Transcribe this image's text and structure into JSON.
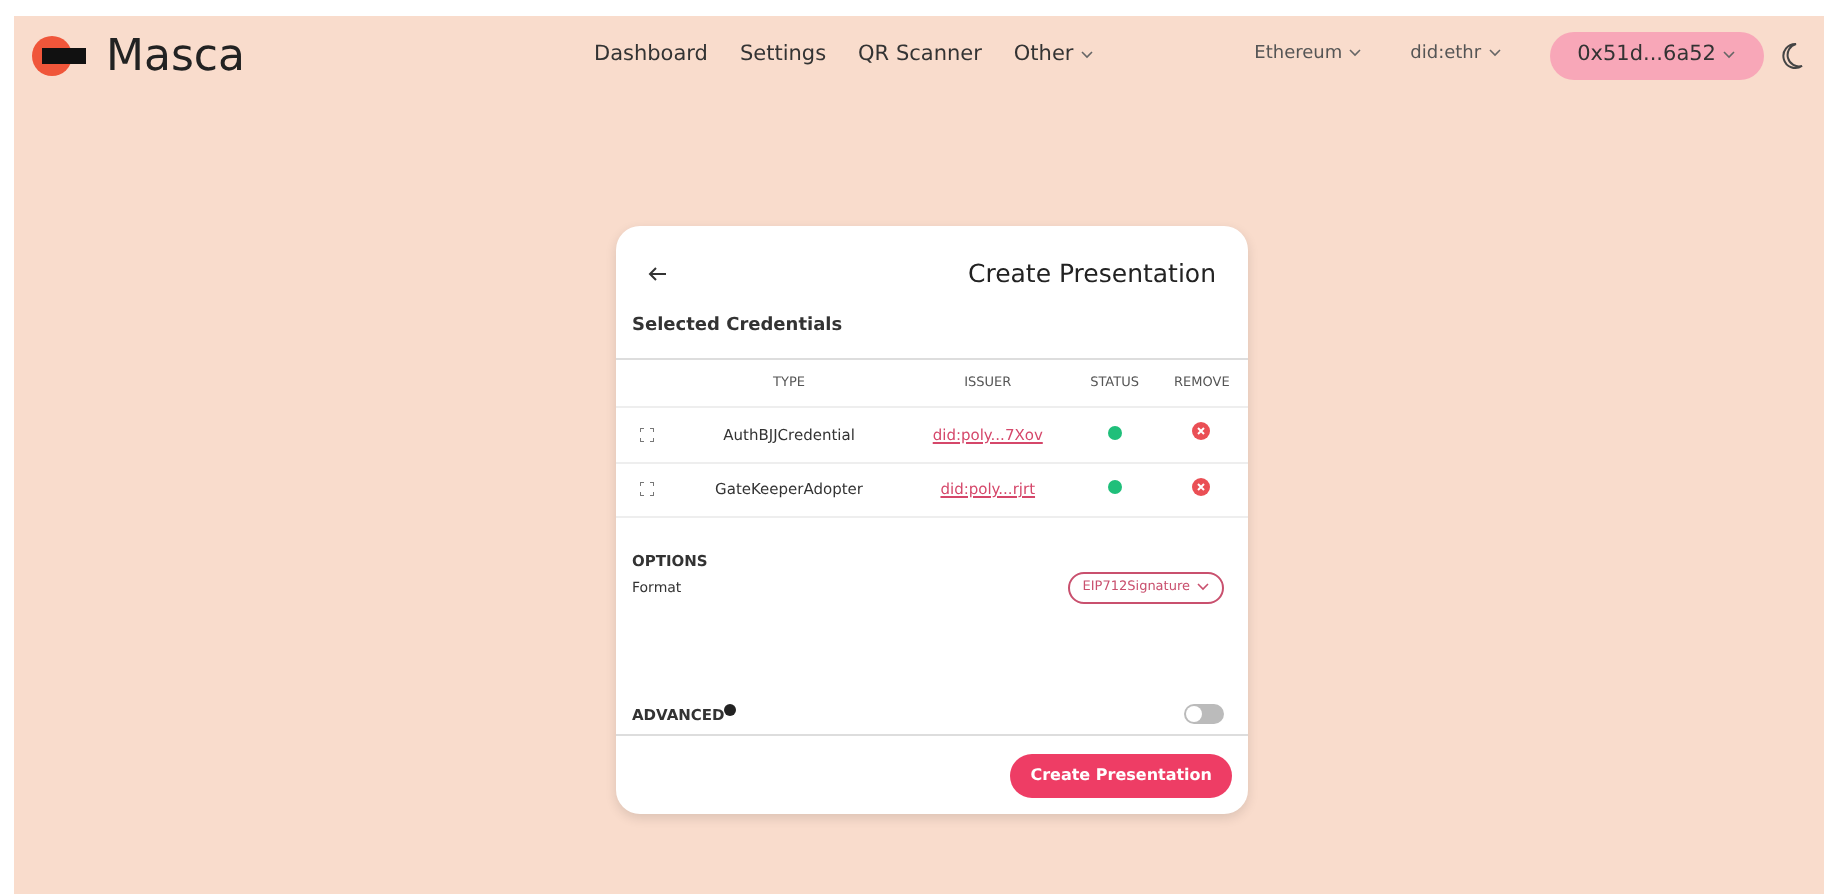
{
  "brand": {
    "name": "Masca"
  },
  "nav": [
    {
      "label": "Dashboard",
      "kind": "link"
    },
    {
      "label": "Settings",
      "kind": "link"
    },
    {
      "label": "QR Scanner",
      "kind": "link"
    },
    {
      "label": "Other",
      "kind": "dropdown"
    }
  ],
  "network": {
    "label": "Ethereum"
  },
  "method": {
    "label": "did:ethr"
  },
  "account": {
    "label": "0x51d...6a52"
  },
  "card": {
    "title": "Create Presentation",
    "section": "Selected Credentials",
    "columns": [
      "TYPE",
      "ISSUER",
      "STATUS",
      "REMOVE"
    ],
    "rows": [
      {
        "type": "AuthBJJCredential",
        "issuer": "did:poly...7Xov",
        "color": "#1fbf7a"
      },
      {
        "type": "GateKeeperAdopter",
        "issuer": "did:poly...rjrt",
        "color": "#1fbf7a"
      }
    ],
    "options_heading": "OPTIONS",
    "format_label": "Format",
    "format_value": "EIP712Signature",
    "advanced_label": "ADVANCED",
    "advanced_on": false,
    "submit": "Create Presentation"
  }
}
